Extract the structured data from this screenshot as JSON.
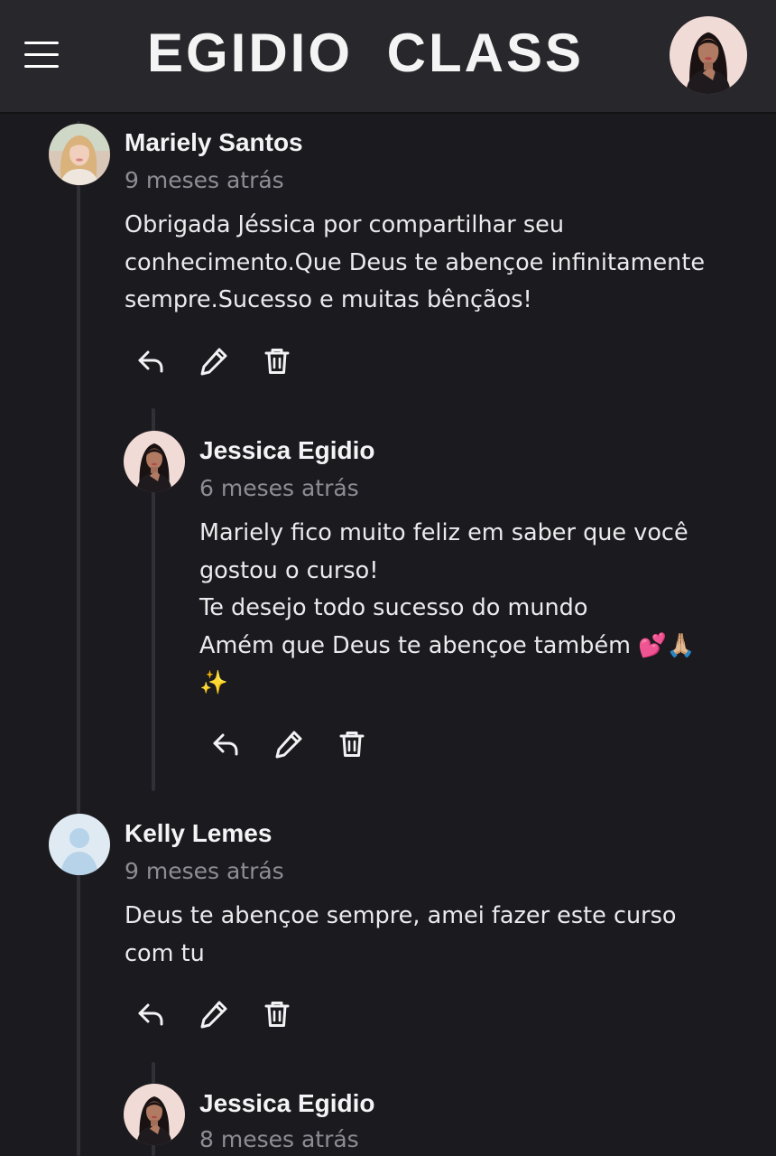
{
  "header": {
    "menu_icon": "hamburger-menu-icon",
    "brand": "EGIDIO  CLASS",
    "profile_avatar": "user-avatar"
  },
  "comments": [
    {
      "author": "Mariely Santos",
      "time": "9 meses atrás",
      "lines": [
        "Obrigada Jéssica por compartilhar seu",
        "conhecimento.Que Deus te abençoe infinitamente",
        "sempre.Sucesso e muitas bênçãos!"
      ],
      "actions": [
        "reply-icon",
        "edit-pencil-icon",
        "delete-trash-icon"
      ],
      "replies": [
        {
          "author": "Jessica Egidio",
          "time": "6 meses atrás",
          "lines": [
            "Mariely fico muito feliz em saber que você",
            "gostou o curso!",
            "Te desejo todo sucesso do mundo",
            "Amém que Deus te abençoe também 💕🙏🏼",
            "✨"
          ],
          "actions": [
            "reply-icon",
            "edit-pencil-icon",
            "delete-trash-icon"
          ]
        }
      ]
    },
    {
      "author": "Kelly Lemes",
      "time": "9 meses atrás",
      "lines": [
        "Deus te abençoe sempre, amei fazer este curso",
        "com tu"
      ],
      "actions": [
        "reply-icon",
        "edit-pencil-icon",
        "delete-trash-icon"
      ],
      "replies": [
        {
          "author": "Jessica Egidio",
          "time": "8 meses atrás"
        }
      ]
    }
  ],
  "colors": {
    "background": "#1b1a1e",
    "header": "#28272c",
    "text": "#f4f4f6",
    "muted": "#8e8d94",
    "thread_line": "#313036"
  }
}
